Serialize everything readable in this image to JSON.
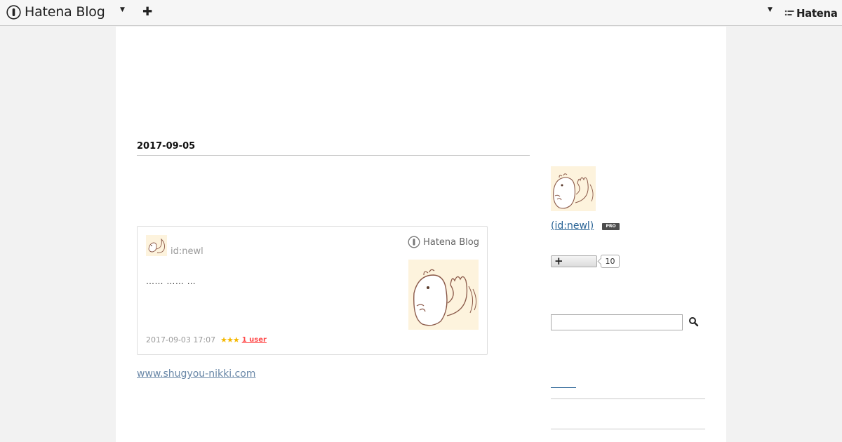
{
  "header": {
    "logo_text": "Hatena Blog",
    "menu_caret_icon": "caret-down-icon",
    "create_icon": "plus-icon",
    "account_caret_icon": "caret-down-icon",
    "brand_text": "Hatena"
  },
  "entry": {
    "date": "2017-09-05",
    "card": {
      "author": "id:newl",
      "brand_text": "Hatena Blog",
      "excerpt": "…… ……  …",
      "timestamp": "2017-09-03 17:07",
      "stars": "★★★",
      "users": "1 user"
    },
    "site_link": "www.shugyou-nikki.com"
  },
  "sidebar": {
    "profile_name": " (id:newl)",
    "pro_badge": "PRO",
    "follow_count": "10",
    "search_placeholder": ""
  },
  "colors": {
    "background": "#f2f2f2",
    "link": "#2a6496",
    "star": "#f5b800",
    "users": "#ff4b4b"
  }
}
